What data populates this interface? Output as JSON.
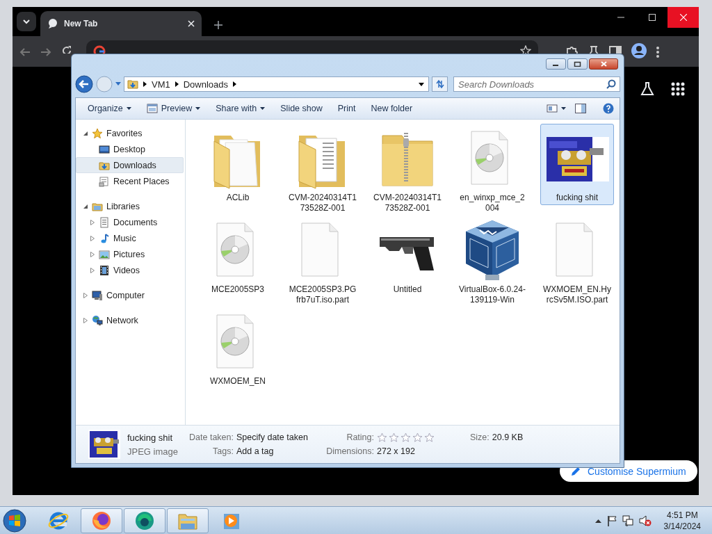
{
  "browser": {
    "tabs": [
      {
        "title": "New Tab",
        "selected": true
      }
    ],
    "customise_button": "Customise Supermium"
  },
  "explorer": {
    "breadcrumb": [
      "VM1",
      "Downloads"
    ],
    "search": {
      "placeholder": "Search Downloads"
    },
    "toolbar": [
      {
        "label": "Organize",
        "dropdown": true,
        "kind": "text"
      },
      {
        "label": "Preview",
        "dropdown": true,
        "kind": "preview"
      },
      {
        "label": "Share with",
        "dropdown": true,
        "kind": "text"
      },
      {
        "label": "Slide show",
        "dropdown": false,
        "kind": "text"
      },
      {
        "label": "Print",
        "dropdown": false,
        "kind": "text"
      },
      {
        "label": "New folder",
        "dropdown": false,
        "kind": "text"
      }
    ],
    "nav": [
      {
        "label": "Favorites",
        "kind": "star",
        "expanded": true,
        "children": [
          {
            "label": "Desktop",
            "kind": "desktop",
            "selected": false
          },
          {
            "label": "Downloads",
            "kind": "downloads",
            "selected": true
          },
          {
            "label": "Recent Places",
            "kind": "recent",
            "selected": false
          }
        ]
      },
      {
        "label": "Libraries",
        "kind": "library",
        "expanded": true,
        "children": [
          {
            "label": "Documents",
            "kind": "documents",
            "selected": false,
            "expanded": false
          },
          {
            "label": "Music",
            "kind": "music",
            "selected": false,
            "expanded": false
          },
          {
            "label": "Pictures",
            "kind": "pictures",
            "selected": false,
            "expanded": false
          },
          {
            "label": "Videos",
            "kind": "videos",
            "selected": false,
            "expanded": false
          }
        ]
      },
      {
        "label": "Computer",
        "kind": "computer",
        "expanded": false
      },
      {
        "label": "Network",
        "kind": "network",
        "expanded": false
      }
    ],
    "files": [
      {
        "name": "ACLib",
        "kind": "folder",
        "selected": false
      },
      {
        "name": "CVM-20240314T173528Z-001",
        "kind": "folder-papers",
        "selected": false
      },
      {
        "name": "CVM-20240314T173528Z-001",
        "kind": "zip",
        "selected": false
      },
      {
        "name": "en_winxp_mce_2004",
        "kind": "disc",
        "selected": false
      },
      {
        "name": "fucking shit",
        "kind": "picture",
        "selected": true
      },
      {
        "name": "MCE2005SP3",
        "kind": "disc",
        "selected": false
      },
      {
        "name": "MCE2005SP3.PGfrb7uT.iso.part",
        "kind": "blank",
        "selected": false
      },
      {
        "name": "Untitled",
        "kind": "picture",
        "selected": false
      },
      {
        "name": "VirtualBox-6.0.24-139119-Win",
        "kind": "cube",
        "selected": false
      },
      {
        "name": "WXMOEM_EN.HyrcSv5M.ISO.part",
        "kind": "blank",
        "selected": false
      },
      {
        "name": "WXMOEM_EN",
        "kind": "disc",
        "selected": false
      }
    ],
    "details": {
      "name": "fucking shit",
      "type": "JPEG image",
      "fields": [
        {
          "label": "Date taken:",
          "value": "Specify date taken",
          "kind": "text"
        },
        {
          "label": "Tags:",
          "value": "Add a tag",
          "kind": "text"
        },
        {
          "label": "Rating:",
          "kind": "rating",
          "stars": 0
        },
        {
          "label": "Dimensions:",
          "value": "272 x 192",
          "kind": "text"
        },
        {
          "label": "Size:",
          "value": "20.9 KB",
          "kind": "text"
        }
      ]
    }
  },
  "taskbar": {
    "apps": [
      {
        "kind": "ie",
        "running": false
      },
      {
        "kind": "firefox",
        "running": true
      },
      {
        "kind": "green-app",
        "running": true
      },
      {
        "kind": "explorer",
        "running": true
      },
      {
        "kind": "media",
        "running": false
      }
    ],
    "clock": {
      "time": "4:51 PM",
      "date": "3/14/2024"
    }
  }
}
